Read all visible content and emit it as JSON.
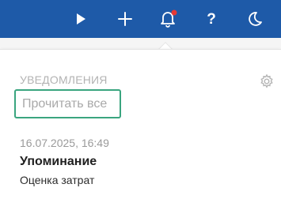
{
  "topbar": {
    "background_color": "#1e5aa8",
    "icons": [
      "play-icon",
      "plus-icon",
      "bell-icon",
      "help-icon",
      "moon-icon"
    ],
    "help_label": "?",
    "bell_badge_color": "#e53935"
  },
  "notifications": {
    "title": "УВЕДОМЛЕНИЯ",
    "mark_all_read": "Прочитать все",
    "highlight_color": "#3aa57f",
    "items": [
      {
        "date": "16.07.2025, 16:49",
        "type": "Упоминание",
        "subject": "Оценка затрат"
      }
    ]
  }
}
